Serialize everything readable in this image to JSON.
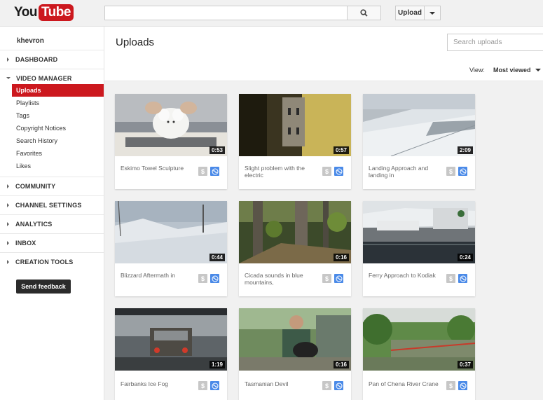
{
  "header": {
    "logo_you": "You",
    "logo_tube": "Tube",
    "search_placeholder": "",
    "upload_label": "Upload"
  },
  "sidebar": {
    "username": "khevron",
    "sections": [
      {
        "label": "DASHBOARD"
      },
      {
        "label": "VIDEO MANAGER"
      },
      {
        "label": "COMMUNITY"
      },
      {
        "label": "CHANNEL SETTINGS"
      },
      {
        "label": "ANALYTICS"
      },
      {
        "label": "INBOX"
      },
      {
        "label": "CREATION TOOLS"
      }
    ],
    "video_manager_items": [
      {
        "label": "Uploads"
      },
      {
        "label": "Playlists"
      },
      {
        "label": "Tags"
      },
      {
        "label": "Copyright Notices"
      },
      {
        "label": "Search History"
      },
      {
        "label": "Favorites"
      },
      {
        "label": "Likes"
      }
    ],
    "feedback_label": "Send feedback"
  },
  "main": {
    "title": "Uploads",
    "search_placeholder": "Search uploads",
    "view_label": "View:",
    "view_value": "Most viewed"
  },
  "videos": [
    {
      "title": "Eskimo Towel Sculpture",
      "duration": "0:53"
    },
    {
      "title": "Slight problem with the electric",
      "duration": "0:57"
    },
    {
      "title": "Landing Approach and landing in",
      "duration": "2:09"
    },
    {
      "title": "Blizzard Aftermath in",
      "duration": "0:44"
    },
    {
      "title": "Cicada sounds in blue mountains,",
      "duration": "0:16"
    },
    {
      "title": "Ferry Approach to Kodiak",
      "duration": "0:24"
    },
    {
      "title": "Fairbanks Ice Fog",
      "duration": "1:19"
    },
    {
      "title": "Tasmanian Devil",
      "duration": "0:16"
    },
    {
      "title": "Pan of Chena River Crane",
      "duration": "0:37"
    }
  ],
  "icons": {
    "search": "magnifier-icon",
    "monetization": "dollar-icon",
    "privacy": "globe-icon"
  },
  "colors": {
    "brand_red": "#cc181e",
    "globe_blue": "#4a8ae8",
    "dollar_gray": "#c7c7c7"
  }
}
